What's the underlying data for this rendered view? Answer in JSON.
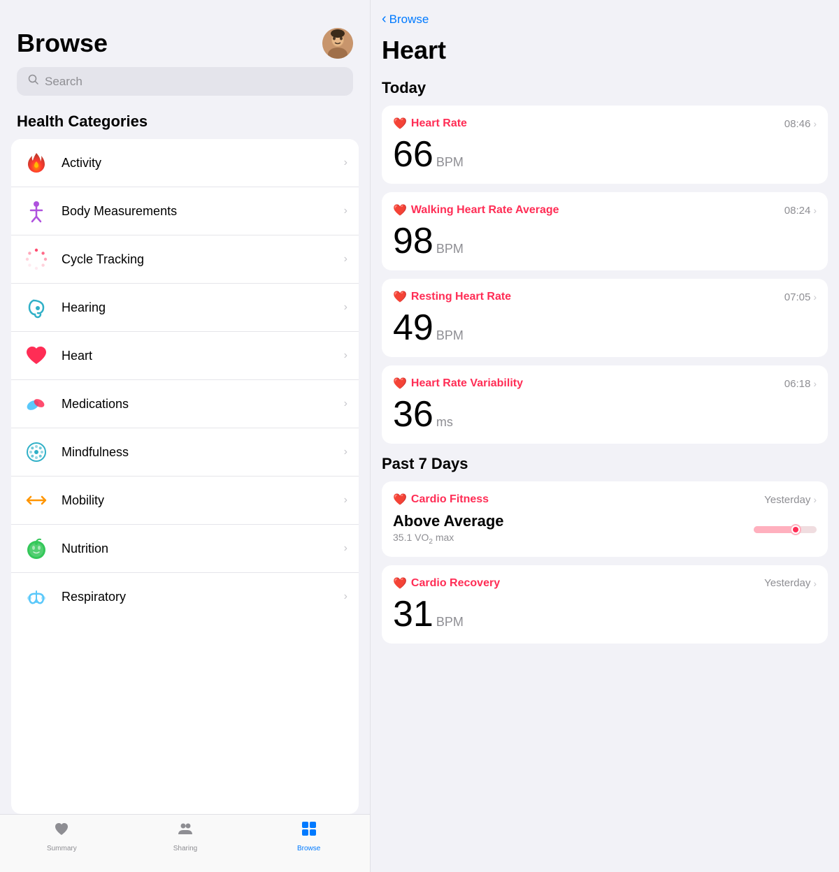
{
  "left": {
    "title": "Browse",
    "search_placeholder": "Search",
    "categories_label": "Health Categories",
    "categories": [
      {
        "id": "activity",
        "name": "Activity",
        "icon": "activity"
      },
      {
        "id": "body",
        "name": "Body Measurements",
        "icon": "body"
      },
      {
        "id": "cycle",
        "name": "Cycle Tracking",
        "icon": "cycle"
      },
      {
        "id": "hearing",
        "name": "Hearing",
        "icon": "hearing"
      },
      {
        "id": "heart",
        "name": "Heart",
        "icon": "heart"
      },
      {
        "id": "medications",
        "name": "Medications",
        "icon": "medications"
      },
      {
        "id": "mindfulness",
        "name": "Mindfulness",
        "icon": "mindfulness"
      },
      {
        "id": "mobility",
        "name": "Mobility",
        "icon": "mobility"
      },
      {
        "id": "nutrition",
        "name": "Nutrition",
        "icon": "nutrition"
      },
      {
        "id": "respiratory",
        "name": "Respiratory",
        "icon": "respiratory"
      }
    ]
  },
  "right": {
    "back_label": "Browse",
    "title": "Heart",
    "today_label": "Today",
    "cards_today": [
      {
        "id": "heart-rate",
        "title": "Heart Rate",
        "time": "08:46",
        "value": "66",
        "unit": "BPM"
      },
      {
        "id": "walking-heart-rate",
        "title": "Walking Heart Rate Average",
        "time": "08:24",
        "value": "98",
        "unit": "BPM"
      },
      {
        "id": "resting-heart-rate",
        "title": "Resting Heart Rate",
        "time": "07:05",
        "value": "49",
        "unit": "BPM"
      },
      {
        "id": "heart-rate-variability",
        "title": "Heart Rate Variability",
        "time": "06:18",
        "value": "36",
        "unit": "ms"
      }
    ],
    "past7days_label": "Past 7 Days",
    "cards_past7": [
      {
        "id": "cardio-fitness",
        "title": "Cardio Fitness",
        "time": "Yesterday",
        "value_label": "Above Average",
        "value_sub": "35.1 VO₂ max",
        "has_chart": true
      },
      {
        "id": "cardio-recovery",
        "title": "Cardio Recovery",
        "time": "Yesterday",
        "value": "31",
        "unit": "BPM"
      }
    ]
  },
  "tabs": {
    "items": [
      {
        "id": "summary",
        "label": "Summary",
        "icon": "heart",
        "active": false
      },
      {
        "id": "sharing",
        "label": "Sharing",
        "icon": "sharing",
        "active": false
      },
      {
        "id": "browse",
        "label": "Browse",
        "icon": "browse",
        "active": true
      }
    ]
  }
}
